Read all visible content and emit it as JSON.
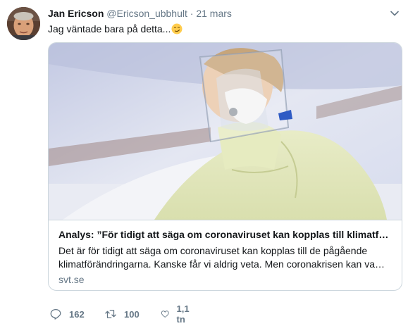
{
  "tweet": {
    "author_name": "Jan Ericson",
    "author_handle": "@Ericson_ubbhult",
    "separator": "·",
    "date": "21 mars",
    "text": "Jag väntade bara på detta...",
    "emoji": "smirking-face"
  },
  "card": {
    "title": "Analys: ”För tidigt att säga om coronaviruset kan kopplas till klimatf…",
    "description": "Det är för tidigt att säga om coronaviruset kan kopplas till de pågående klimatförändringarna. Kanske får vi aldrig veta. Men coronakrisen kan va…",
    "domain": "svt.se"
  },
  "actions": {
    "replies": "162",
    "retweets": "100",
    "likes": "1,1 tn"
  },
  "colors": {
    "secondary_text": "#657786",
    "border": "#ccd6dd",
    "primary_text": "#14171a"
  }
}
